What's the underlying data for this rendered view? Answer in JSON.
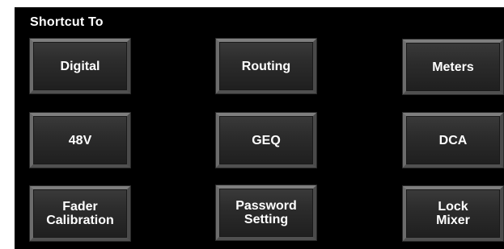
{
  "panel": {
    "title": "Shortcut To"
  },
  "buttons": {
    "digital": "Digital",
    "routing": "Routing",
    "meters": "Meters",
    "phantom_48v": "48V",
    "geq": "GEQ",
    "dca": "DCA",
    "fader_calibration": "Fader\nCalibration",
    "password_setting": "Password\nSetting",
    "lock_mixer": "Lock\nMixer"
  },
  "colors": {
    "background": "#000000",
    "button_face": "#2c2c2c",
    "button_bevel": "#7e7e7e",
    "text": "#ffffff"
  }
}
